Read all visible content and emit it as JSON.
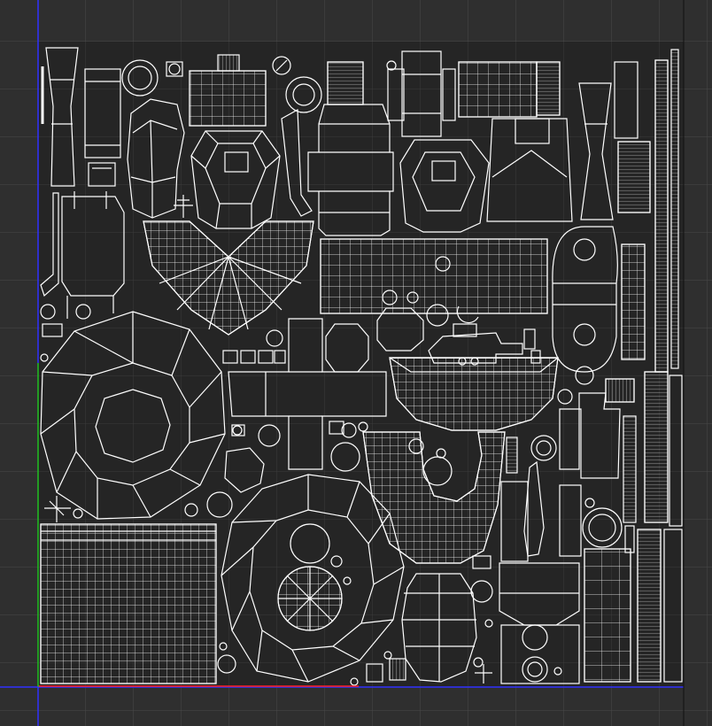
{
  "editor": {
    "view": "uv-editor",
    "background_color": "#2f2f2f",
    "grid_color": "#4a4a4a",
    "uv_tile_color": "#252525",
    "wire_color": "#ffffff",
    "axis_u_color": "#ff2020",
    "axis_v_color": "#20c020",
    "border_color": "#3030ff"
  }
}
